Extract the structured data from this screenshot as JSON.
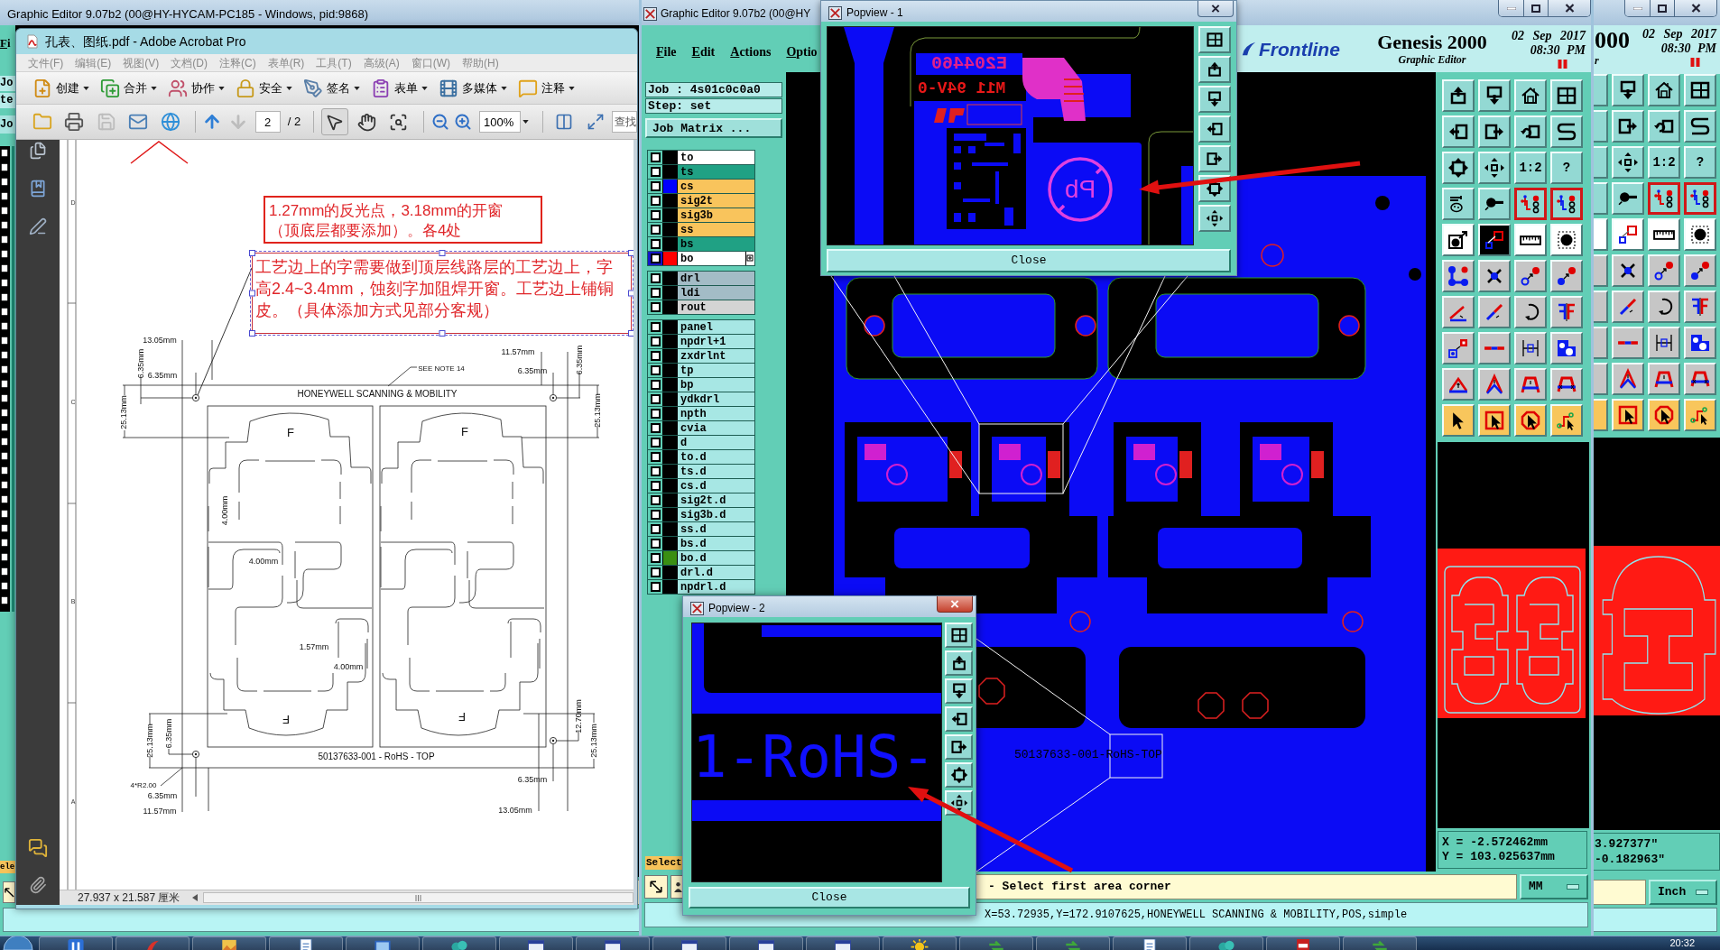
{
  "desktop_editor": {
    "title": "Graphic Editor 9.07b2 (00@HY-HYCAM-PC185 - Windows, pid:9868)",
    "menu_fragment": "Fi",
    "panel_fragments": [
      "Jo",
      "te",
      "Jo"
    ],
    "select_fragment": "ele",
    "product_fragment": "000",
    "subtitle_fragment": "r",
    "date": "02 Sep 2017",
    "time": "08:30 PM",
    "toolbar": [
      {
        "kind": "view",
        "on": false
      },
      {
        "kind": "view",
        "on": false
      },
      {
        "kind": "view",
        "on": false
      },
      {
        "kind": "view",
        "on": false
      },
      {
        "kind": "view",
        "on": false
      },
      {
        "kind": "view",
        "on": false
      },
      {
        "kind": "view",
        "on": false
      },
      {
        "kind": "view",
        "on": false
      },
      {
        "kind": "view",
        "on": false
      },
      {
        "kind": "view",
        "on": false
      },
      {
        "kind": "view",
        "label": "1:2",
        "on": false
      },
      {
        "kind": "view",
        "label": "?",
        "on": false
      },
      {
        "kind": "view",
        "on": false
      },
      {
        "kind": "view",
        "on": false
      },
      {
        "kind": "view",
        "on": true
      },
      {
        "kind": "view",
        "on": true
      },
      {
        "kind": "mode",
        "on": false
      },
      {
        "kind": "mode",
        "on": false
      },
      {
        "kind": "mode",
        "on": false
      },
      {
        "kind": "mode",
        "on": false
      },
      {
        "kind": "edit",
        "on": false
      },
      {
        "kind": "edit",
        "on": false
      },
      {
        "kind": "edit",
        "on": false
      },
      {
        "kind": "edit",
        "on": false
      },
      {
        "kind": "edit",
        "on": false
      },
      {
        "kind": "edit",
        "on": false
      },
      {
        "kind": "edit",
        "on": false
      },
      {
        "kind": "edit",
        "on": false
      },
      {
        "kind": "edit",
        "on": false
      },
      {
        "kind": "edit",
        "on": false
      },
      {
        "kind": "edit",
        "on": false
      },
      {
        "kind": "edit",
        "on": false
      },
      {
        "kind": "edit",
        "on": false
      },
      {
        "kind": "edit",
        "on": false
      },
      {
        "kind": "edit",
        "on": false
      },
      {
        "kind": "edit",
        "on": false
      },
      {
        "kind": "select",
        "on": false
      },
      {
        "kind": "select",
        "on": false
      },
      {
        "kind": "select",
        "on": false
      },
      {
        "kind": "select",
        "on": false
      }
    ],
    "coord_x": "3.927377\"",
    "coord_y": "-0.182963\"",
    "units": "Inch"
  },
  "acrobat": {
    "title": "孔表、图纸.pdf - Adobe Acrobat Pro",
    "menu": [
      "文件(F)",
      "编辑(E)",
      "视图(V)",
      "文档(D)",
      "注释(C)",
      "表单(R)",
      "工具(T)",
      "高级(A)",
      "窗口(W)",
      "帮助(H)"
    ],
    "tasks": [
      "创建",
      "合并",
      "协作",
      "安全",
      "签名",
      "表单",
      "多媒体",
      "注释"
    ],
    "file_tools": [
      {
        "disabled": false
      },
      {
        "disabled": false
      },
      {
        "disabled": true
      },
      {
        "disabled": false
      },
      {
        "disabled": false
      }
    ],
    "page_tools": [
      {
        "disabled": false
      },
      {
        "disabled": true
      }
    ],
    "page": "2",
    "page_count": "/ 2",
    "pointer_tools": [
      {
        "selected": true
      },
      {
        "selected": false
      },
      {
        "selected": false
      }
    ],
    "zoom": "100%",
    "search_placeholder": "查找",
    "notes": [
      {
        "lines": [
          "1.27mm的反光点，3.18mm的开窗",
          "（顶底层都要添加）。各4处"
        ],
        "selected": false
      },
      {
        "lines": [
          "工艺边上的字需要做到顶层线路层的工艺边上，字",
          "高2.4~3.4mm，蚀刻字加阻焊开窗。工艺边上铺铜",
          "皮。（具体添加方式见部分客规）"
        ],
        "selected": true
      }
    ],
    "zone_letters": [
      "D",
      "C",
      "B",
      "A"
    ],
    "drawing_labels": [
      {
        "text": "13.05mm",
        "kind": "horizontal"
      },
      {
        "text": "6.35mm",
        "kind": "vertical"
      },
      {
        "text": "6.35mm",
        "kind": "horizontal"
      },
      {
        "text": "25.13mm",
        "kind": "vertical"
      },
      {
        "text": "SEE NOTE 14",
        "kind": "horizontal"
      },
      {
        "text": "HONEYWELL SCANNING & MOBILITY",
        "kind": "horizontal"
      },
      {
        "text": "11.57mm",
        "kind": "horizontal"
      },
      {
        "text": "6.35mm",
        "kind": "vertical"
      },
      {
        "text": "6.35mm",
        "kind": "horizontal"
      },
      {
        "text": "25.13mm",
        "kind": "vertical"
      },
      {
        "text": "F",
        "kind": "horizontal"
      },
      {
        "text": "F",
        "kind": "horizontal"
      },
      {
        "text": "4.00mm",
        "kind": "vertical"
      },
      {
        "text": "4.00mm",
        "kind": "horizontal"
      },
      {
        "text": "1.57mm",
        "kind": "horizontal"
      },
      {
        "text": "4.00mm",
        "kind": "horizontal"
      },
      {
        "text": "F",
        "kind": "inverted"
      },
      {
        "text": "F",
        "kind": "inverted"
      },
      {
        "text": "25.13mm",
        "kind": "vertical"
      },
      {
        "text": "6.35mm",
        "kind": "vertical"
      },
      {
        "text": "12.70mm",
        "kind": "vertical"
      },
      {
        "text": "25.13mm",
        "kind": "vertical"
      },
      {
        "text": "50137633-001 - RoHS - TOP",
        "kind": "horizontal"
      },
      {
        "text": "4*R2.00",
        "kind": "horizontal"
      },
      {
        "text": "6.35mm",
        "kind": "horizontal"
      },
      {
        "text": "11.57mm",
        "kind": "horizontal"
      },
      {
        "text": "6.35mm",
        "kind": "horizontal"
      },
      {
        "text": "13.05mm",
        "kind": "horizontal"
      }
    ],
    "page_size": "27.937 x 21.587 厘米"
  },
  "editor": {
    "title": "Graphic Editor 9.07b2 (00@HY",
    "menu": [
      "File",
      "Edit",
      "Actions",
      "Optio"
    ],
    "brand": "Frontline",
    "product": "Genesis 2000",
    "subtitle": "Graphic Editor",
    "date": "02 Sep 2017",
    "time": "08:30 PM",
    "job": "Job : 4s01c0c0a0",
    "step": "Step: set",
    "job_matrix": "Job Matrix ...",
    "layer_groups": [
      {
        "layers": [
          {
            "name": "to",
            "kind": "silk",
            "selected": false
          },
          {
            "name": "ts",
            "kind": "mask",
            "selected": false
          },
          {
            "name": "cs",
            "kind": "signal",
            "color": "#0000ff",
            "selected": false
          },
          {
            "name": "sig2t",
            "kind": "signal",
            "selected": false
          },
          {
            "name": "sig3b",
            "kind": "signal",
            "selected": false
          },
          {
            "name": "ss",
            "kind": "signal",
            "selected": false
          },
          {
            "name": "bs",
            "kind": "mask",
            "selected": false
          },
          {
            "name": "bo",
            "kind": "silk",
            "color": "#ff0000",
            "selected": true
          }
        ]
      },
      {
        "layers": [
          {
            "name": "drl",
            "kind": "drill",
            "selected": false
          },
          {
            "name": "ldi",
            "kind": "drill",
            "selected": false
          },
          {
            "name": "rout",
            "kind": "rout",
            "selected": false
          }
        ]
      },
      {
        "layers": [
          {
            "name": "panel",
            "kind": "misc",
            "selected": false
          },
          {
            "name": "npdrl+1",
            "kind": "misc",
            "selected": false
          },
          {
            "name": "zxdrlnt",
            "kind": "misc",
            "selected": false
          },
          {
            "name": "tp",
            "kind": "misc",
            "selected": false
          },
          {
            "name": "bp",
            "kind": "misc",
            "selected": false
          },
          {
            "name": "ydkdrl",
            "kind": "misc",
            "selected": false
          },
          {
            "name": "npth",
            "kind": "misc",
            "selected": false
          },
          {
            "name": "cvia",
            "kind": "misc",
            "selected": false
          },
          {
            "name": "d",
            "kind": "misc",
            "selected": false
          },
          {
            "name": "to.d",
            "kind": "misc",
            "selected": false
          },
          {
            "name": "ts.d",
            "kind": "misc",
            "selected": false
          },
          {
            "name": "cs.d",
            "kind": "misc",
            "selected": false
          },
          {
            "name": "sig2t.d",
            "kind": "misc",
            "selected": false
          },
          {
            "name": "sig3b.d",
            "kind": "misc",
            "selected": false
          },
          {
            "name": "ss.d",
            "kind": "misc",
            "selected": false
          },
          {
            "name": "bs.d",
            "kind": "misc",
            "selected": false
          },
          {
            "name": "bo.d",
            "kind": "misc",
            "color": "#3a8f12",
            "selected": false
          },
          {
            "name": "drl.d",
            "kind": "misc",
            "selected": false
          },
          {
            "name": "npdrl.d",
            "kind": "misc",
            "selected": false
          }
        ]
      }
    ],
    "select": "Select",
    "toolbar": [
      {
        "kind": "view",
        "on": false
      },
      {
        "kind": "view",
        "on": false
      },
      {
        "kind": "view",
        "on": false
      },
      {
        "kind": "view",
        "on": false
      },
      {
        "kind": "view",
        "on": false
      },
      {
        "kind": "view",
        "on": false
      },
      {
        "kind": "view",
        "on": false
      },
      {
        "kind": "view",
        "on": false
      },
      {
        "kind": "view",
        "on": false
      },
      {
        "kind": "view",
        "on": false
      },
      {
        "kind": "view",
        "label": "1:2",
        "on": false
      },
      {
        "kind": "view",
        "label": "?",
        "on": false
      },
      {
        "kind": "view",
        "on": false
      },
      {
        "kind": "view",
        "on": false
      },
      {
        "kind": "view",
        "on": true
      },
      {
        "kind": "view",
        "on": true
      },
      {
        "kind": "mode",
        "on": false
      },
      {
        "kind": "mode",
        "on": true
      },
      {
        "kind": "mode",
        "on": false
      },
      {
        "kind": "mode",
        "on": false
      },
      {
        "kind": "edit",
        "on": false
      },
      {
        "kind": "edit",
        "on": false
      },
      {
        "kind": "edit",
        "on": false
      },
      {
        "kind": "edit",
        "on": false
      },
      {
        "kind": "edit",
        "on": false
      },
      {
        "kind": "edit",
        "on": false
      },
      {
        "kind": "edit",
        "on": false
      },
      {
        "kind": "edit",
        "on": false
      },
      {
        "kind": "edit",
        "on": false
      },
      {
        "kind": "edit",
        "on": false
      },
      {
        "kind": "edit",
        "on": false
      },
      {
        "kind": "edit",
        "on": false
      },
      {
        "kind": "edit",
        "on": false
      },
      {
        "kind": "edit",
        "on": false
      },
      {
        "kind": "edit",
        "on": false
      },
      {
        "kind": "edit",
        "on": false
      },
      {
        "kind": "select",
        "on": false
      },
      {
        "kind": "select",
        "on": false
      },
      {
        "kind": "select",
        "on": false
      },
      {
        "kind": "select",
        "on": false
      }
    ],
    "canvas_label": "50137633-001-RoHS-TOP",
    "coord_x": "X = -2.572462mm",
    "coord_y": "Y = 103.025637mm",
    "prompt": "- Select first area corner",
    "units": "MM",
    "command": "X=53.72935,Y=172.9107625,HONEYWELL SCANNING & MOBILITY,POS,simple"
  },
  "popviews": [
    {
      "title": "Popview - 1",
      "active": false,
      "labels": [
        "E204460",
        "M11 94V-0",
        "Pb"
      ],
      "close": "Close"
    },
    {
      "title": "Popview - 2",
      "active": true,
      "labels": [
        "1-RoHS-"
      ],
      "close": "Close"
    }
  ],
  "taskbar": {
    "buttons": [
      {
        "kind": "media"
      },
      {
        "kind": "swirl"
      },
      {
        "kind": "picture"
      },
      {
        "kind": "document"
      },
      {
        "kind": "monitor"
      },
      {
        "kind": "network"
      },
      {
        "kind": "window"
      },
      {
        "kind": "window"
      },
      {
        "kind": "window"
      },
      {
        "kind": "window"
      },
      {
        "kind": "window"
      },
      {
        "kind": "sun"
      },
      {
        "kind": "arrows"
      },
      {
        "kind": "arrows"
      },
      {
        "kind": "document"
      },
      {
        "kind": "network"
      },
      {
        "kind": "pdf"
      },
      {
        "kind": "arrows"
      }
    ],
    "clock": "20:32"
  }
}
